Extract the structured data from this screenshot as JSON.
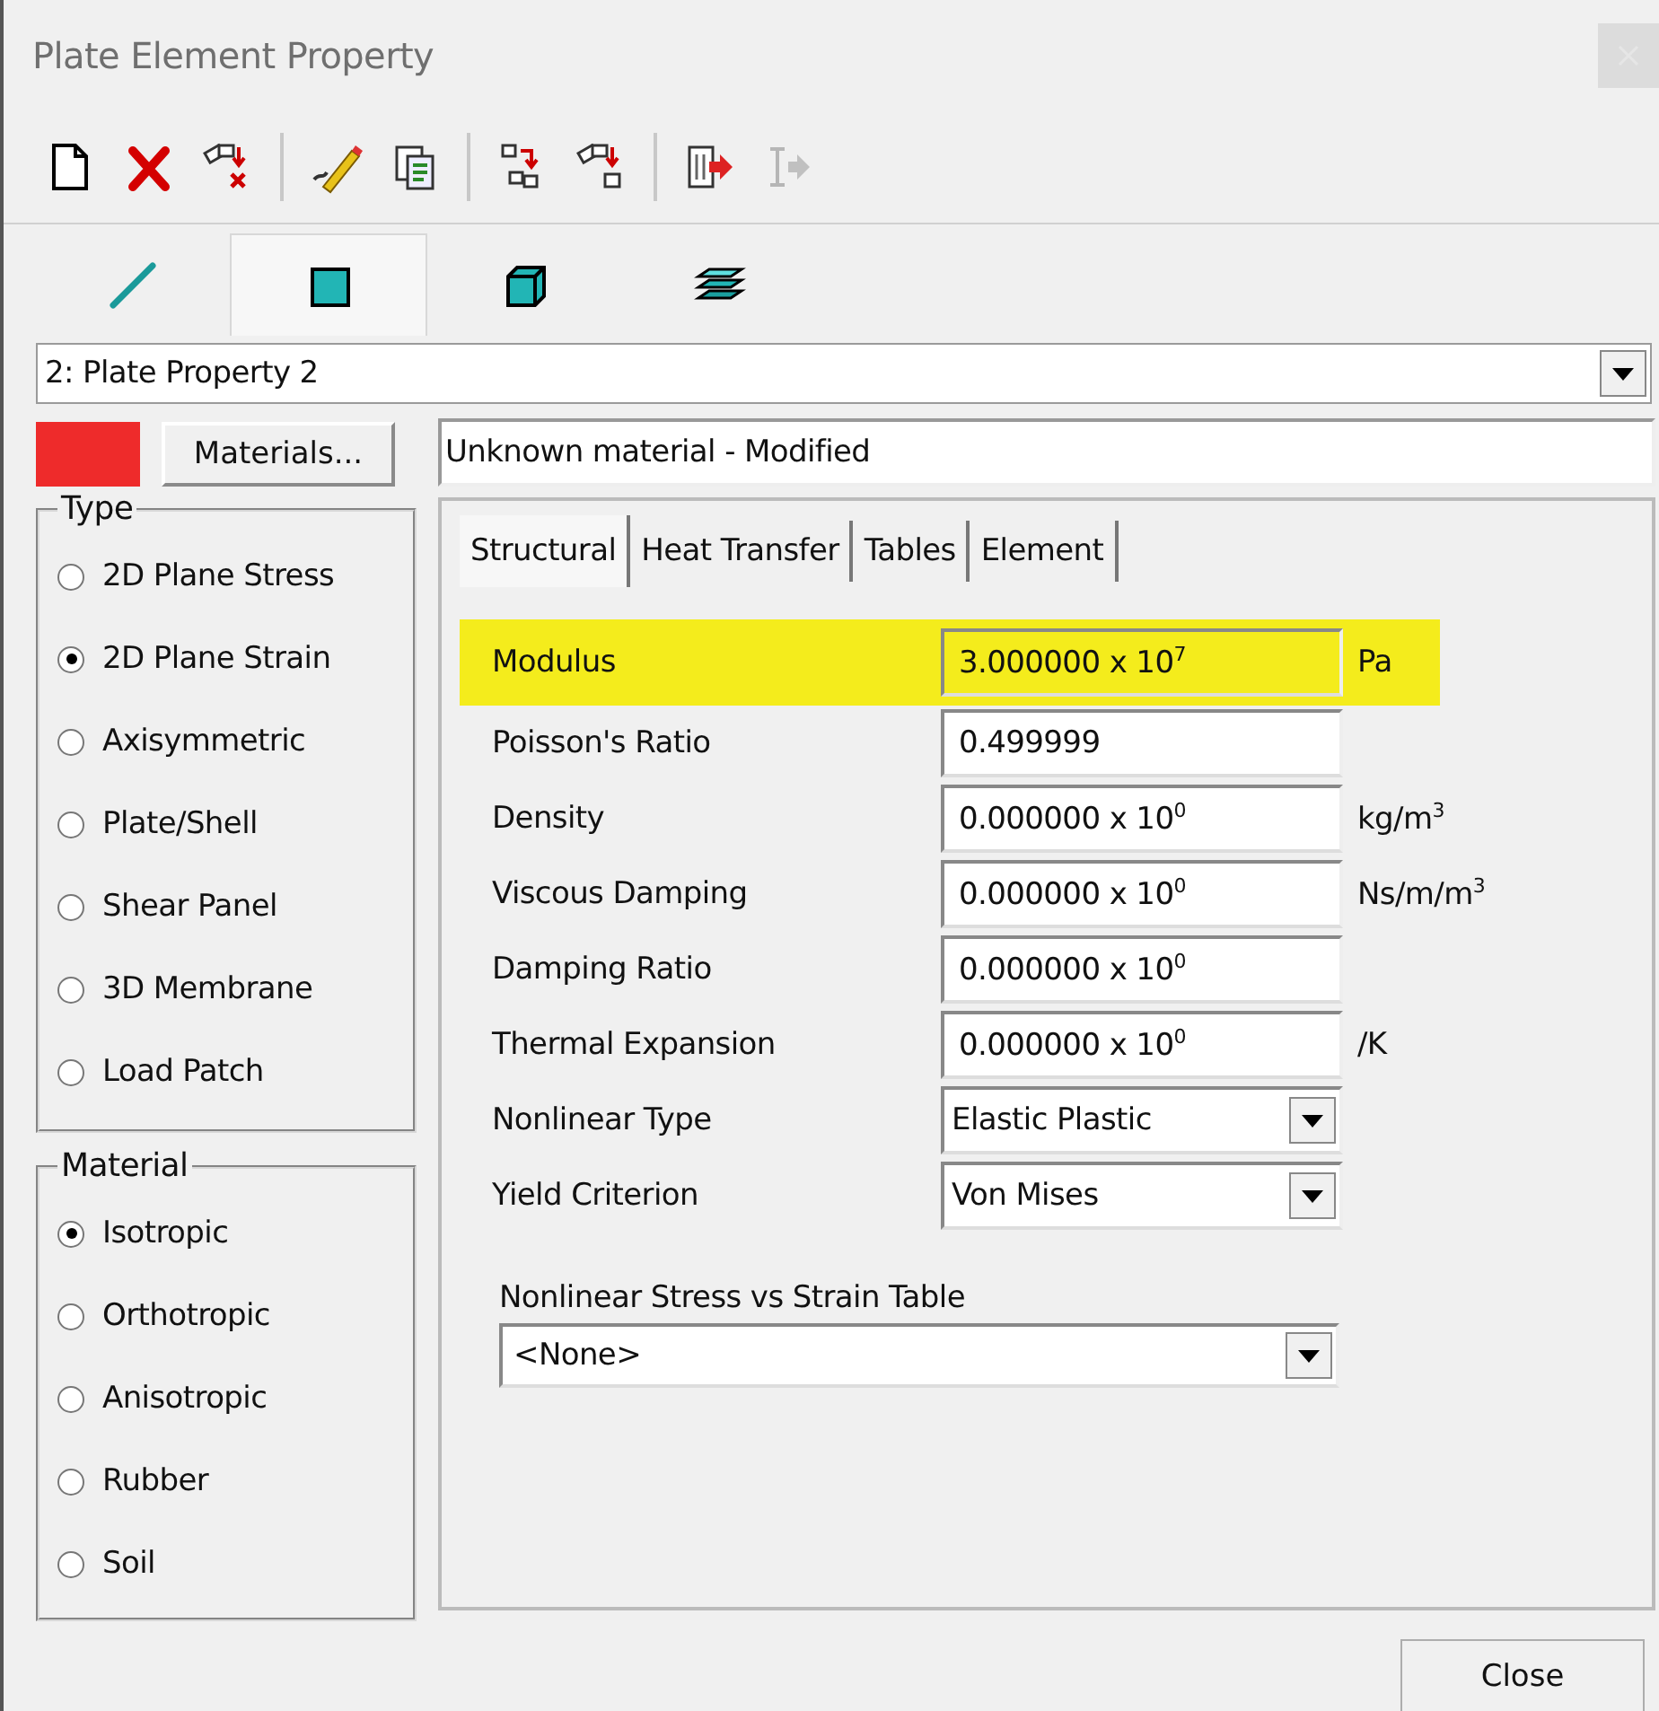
{
  "window": {
    "title": "Plate Element Property"
  },
  "toolbar": [
    {
      "kind": "new",
      "separator_before": false,
      "disabled": false
    },
    {
      "kind": "delete",
      "separator_before": false,
      "disabled": false
    },
    {
      "kind": "erase",
      "separator_before": false,
      "disabled": false
    },
    {
      "kind": "edit",
      "separator_before": true,
      "disabled": false
    },
    {
      "kind": "copy",
      "separator_before": false,
      "disabled": false
    },
    {
      "kind": "assign",
      "separator_before": true,
      "disabled": false
    },
    {
      "kind": "assign-one",
      "separator_before": false,
      "disabled": false
    },
    {
      "kind": "export",
      "separator_before": true,
      "disabled": false
    },
    {
      "kind": "export-text",
      "separator_before": false,
      "disabled": true
    }
  ],
  "element_tabs": [
    {
      "kind": "line",
      "selected": false
    },
    {
      "kind": "plate",
      "selected": true
    },
    {
      "kind": "brick",
      "selected": false
    },
    {
      "kind": "laminate",
      "selected": false
    }
  ],
  "property_select": {
    "value": "2: Plate Property 2"
  },
  "material": {
    "color": "#ee2b2b",
    "button": "Materials...",
    "name": "Unknown material - Modified"
  },
  "type_group": {
    "label": "Type",
    "options": [
      {
        "label": "2D Plane Stress",
        "selected": false
      },
      {
        "label": "2D Plane Strain",
        "selected": true
      },
      {
        "label": "Axisymmetric",
        "selected": false
      },
      {
        "label": "Plate/Shell",
        "selected": false
      },
      {
        "label": "Shear Panel",
        "selected": false
      },
      {
        "label": "3D Membrane",
        "selected": false
      },
      {
        "label": "Load Patch",
        "selected": false
      }
    ]
  },
  "material_group": {
    "label": "Material",
    "options": [
      {
        "label": "Isotropic",
        "selected": true
      },
      {
        "label": "Orthotropic",
        "selected": false
      },
      {
        "label": "Anisotropic",
        "selected": false
      },
      {
        "label": "Rubber",
        "selected": false
      },
      {
        "label": "Soil",
        "selected": false
      }
    ]
  },
  "tabs": [
    {
      "label": "Structural",
      "selected": true
    },
    {
      "label": "Heat Transfer",
      "selected": false
    },
    {
      "label": "Tables",
      "selected": false
    },
    {
      "label": "Element",
      "selected": false
    }
  ],
  "properties": [
    {
      "kind": "number",
      "label": "Modulus",
      "value": "3.000000 x 10$^{7}$",
      "unit": "Pa",
      "highlighted": true
    },
    {
      "kind": "number",
      "label": "Poisson's Ratio",
      "value": "0.499999",
      "highlighted": false
    },
    {
      "kind": "number",
      "label": "Density",
      "value": "0.000000 x 10$^{0}$",
      "unit": "kg/m$^{3}$",
      "highlighted": false
    },
    {
      "kind": "number",
      "label": "Viscous Damping",
      "value": "0.000000 x 10$^{0}$",
      "unit": "Ns/m/m$^{3}$",
      "highlighted": false
    },
    {
      "kind": "number",
      "label": "Damping Ratio",
      "value": "0.000000 x 10$^{0}$",
      "highlighted": false
    },
    {
      "kind": "number",
      "label": "Thermal Expansion",
      "value": "0.000000 x 10$^{0}$",
      "unit": "/K",
      "highlighted": false
    },
    {
      "kind": "dropdown",
      "label": "Nonlinear Type",
      "value": "Elastic Plastic",
      "highlighted": false
    },
    {
      "kind": "dropdown",
      "label": "Yield Criterion",
      "value": "Von Mises",
      "highlighted": false
    }
  ],
  "table_select": {
    "label": "Nonlinear Stress vs Strain Table",
    "value": "<None>"
  },
  "buttons": [
    "Close"
  ]
}
